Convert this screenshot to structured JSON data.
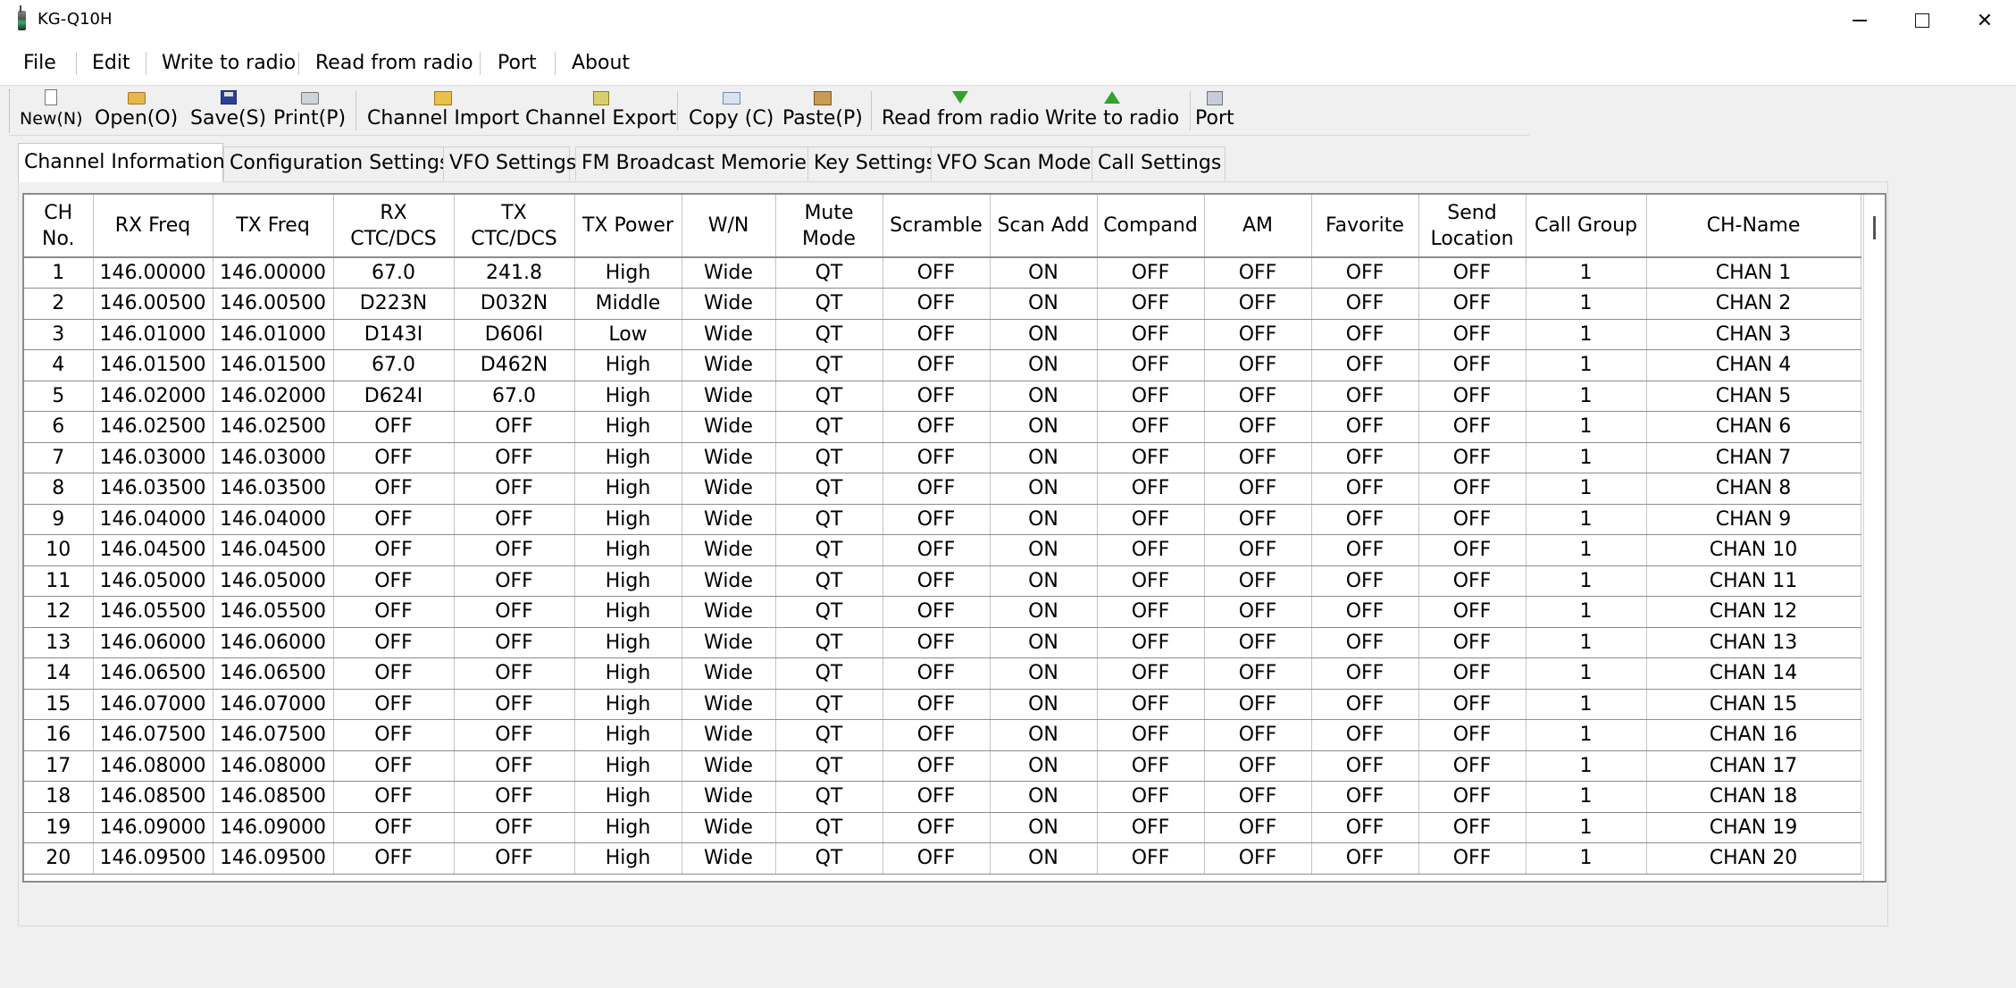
{
  "window": {
    "title": "KG-Q10H",
    "minimize_icon": "minimize-icon",
    "maximize_icon": "maximize-icon",
    "close_icon": "close-icon"
  },
  "menu": [
    "File",
    "Edit",
    "Write to radio",
    "Read from radio",
    "Port",
    "About"
  ],
  "toolbar": [
    {
      "label": "New(N)",
      "icon": "new-file-icon"
    },
    {
      "label": "Open(O)",
      "icon": "open-folder-icon"
    },
    {
      "label": "Save(S)",
      "icon": "save-disk-icon"
    },
    {
      "label": "Print(P)",
      "icon": "printer-icon"
    },
    {
      "label": "Channel Import",
      "icon": "channel-import-icon"
    },
    {
      "label": "Channel Export",
      "icon": "channel-export-icon"
    },
    {
      "label": "Copy (C)",
      "icon": "copy-icon"
    },
    {
      "label": "Paste(P)",
      "icon": "paste-icon"
    },
    {
      "label": "Read from radio",
      "icon": "download-arrow-icon"
    },
    {
      "label": "Write to radio",
      "icon": "upload-arrow-icon"
    },
    {
      "label": "Port",
      "icon": "port-icon"
    }
  ],
  "tabs": [
    "Channel Information",
    "Configuration Settings",
    "VFO Settings",
    "FM Broadcast Memories",
    "Key Settings",
    "VFO Scan Mode",
    "Call Settings"
  ],
  "active_tab": "Channel Information",
  "table": {
    "headers": [
      [
        "CH",
        "No."
      ],
      [
        "RX Freq"
      ],
      [
        "TX Freq"
      ],
      [
        "RX",
        "CTC/DCS"
      ],
      [
        "TX",
        "CTC/DCS"
      ],
      [
        "TX Power"
      ],
      [
        "W/N"
      ],
      [
        "Mute",
        "Mode"
      ],
      [
        "Scramble"
      ],
      [
        "Scan Add"
      ],
      [
        "Compand"
      ],
      [
        "AM"
      ],
      [
        "Favorite"
      ],
      [
        "Send",
        "Location"
      ],
      [
        "Call Group"
      ],
      [
        "CH-Name"
      ]
    ],
    "rows": [
      [
        "1",
        "146.00000",
        "146.00000",
        "67.0",
        "241.8",
        "High",
        "Wide",
        "QT",
        "OFF",
        "ON",
        "OFF",
        "OFF",
        "OFF",
        "OFF",
        "1",
        "CHAN 1"
      ],
      [
        "2",
        "146.00500",
        "146.00500",
        "D223N",
        "D032N",
        "Middle",
        "Wide",
        "QT",
        "OFF",
        "ON",
        "OFF",
        "OFF",
        "OFF",
        "OFF",
        "1",
        "CHAN 2"
      ],
      [
        "3",
        "146.01000",
        "146.01000",
        "D143I",
        "D606I",
        "Low",
        "Wide",
        "QT",
        "OFF",
        "ON",
        "OFF",
        "OFF",
        "OFF",
        "OFF",
        "1",
        "CHAN 3"
      ],
      [
        "4",
        "146.01500",
        "146.01500",
        "67.0",
        "D462N",
        "High",
        "Wide",
        "QT",
        "OFF",
        "ON",
        "OFF",
        "OFF",
        "OFF",
        "OFF",
        "1",
        "CHAN 4"
      ],
      [
        "5",
        "146.02000",
        "146.02000",
        "D624I",
        "67.0",
        "High",
        "Wide",
        "QT",
        "OFF",
        "ON",
        "OFF",
        "OFF",
        "OFF",
        "OFF",
        "1",
        "CHAN 5"
      ],
      [
        "6",
        "146.02500",
        "146.02500",
        "OFF",
        "OFF",
        "High",
        "Wide",
        "QT",
        "OFF",
        "ON",
        "OFF",
        "OFF",
        "OFF",
        "OFF",
        "1",
        "CHAN 6"
      ],
      [
        "7",
        "146.03000",
        "146.03000",
        "OFF",
        "OFF",
        "High",
        "Wide",
        "QT",
        "OFF",
        "ON",
        "OFF",
        "OFF",
        "OFF",
        "OFF",
        "1",
        "CHAN 7"
      ],
      [
        "8",
        "146.03500",
        "146.03500",
        "OFF",
        "OFF",
        "High",
        "Wide",
        "QT",
        "OFF",
        "ON",
        "OFF",
        "OFF",
        "OFF",
        "OFF",
        "1",
        "CHAN 8"
      ],
      [
        "9",
        "146.04000",
        "146.04000",
        "OFF",
        "OFF",
        "High",
        "Wide",
        "QT",
        "OFF",
        "ON",
        "OFF",
        "OFF",
        "OFF",
        "OFF",
        "1",
        "CHAN 9"
      ],
      [
        "10",
        "146.04500",
        "146.04500",
        "OFF",
        "OFF",
        "High",
        "Wide",
        "QT",
        "OFF",
        "ON",
        "OFF",
        "OFF",
        "OFF",
        "OFF",
        "1",
        "CHAN 10"
      ],
      [
        "11",
        "146.05000",
        "146.05000",
        "OFF",
        "OFF",
        "High",
        "Wide",
        "QT",
        "OFF",
        "ON",
        "OFF",
        "OFF",
        "OFF",
        "OFF",
        "1",
        "CHAN 11"
      ],
      [
        "12",
        "146.05500",
        "146.05500",
        "OFF",
        "OFF",
        "High",
        "Wide",
        "QT",
        "OFF",
        "ON",
        "OFF",
        "OFF",
        "OFF",
        "OFF",
        "1",
        "CHAN 12"
      ],
      [
        "13",
        "146.06000",
        "146.06000",
        "OFF",
        "OFF",
        "High",
        "Wide",
        "QT",
        "OFF",
        "ON",
        "OFF",
        "OFF",
        "OFF",
        "OFF",
        "1",
        "CHAN 13"
      ],
      [
        "14",
        "146.06500",
        "146.06500",
        "OFF",
        "OFF",
        "High",
        "Wide",
        "QT",
        "OFF",
        "ON",
        "OFF",
        "OFF",
        "OFF",
        "OFF",
        "1",
        "CHAN 14"
      ],
      [
        "15",
        "146.07000",
        "146.07000",
        "OFF",
        "OFF",
        "High",
        "Wide",
        "QT",
        "OFF",
        "ON",
        "OFF",
        "OFF",
        "OFF",
        "OFF",
        "1",
        "CHAN 15"
      ],
      [
        "16",
        "146.07500",
        "146.07500",
        "OFF",
        "OFF",
        "High",
        "Wide",
        "QT",
        "OFF",
        "ON",
        "OFF",
        "OFF",
        "OFF",
        "OFF",
        "1",
        "CHAN 16"
      ],
      [
        "17",
        "146.08000",
        "146.08000",
        "OFF",
        "OFF",
        "High",
        "Wide",
        "QT",
        "OFF",
        "ON",
        "OFF",
        "OFF",
        "OFF",
        "OFF",
        "1",
        "CHAN 17"
      ],
      [
        "18",
        "146.08500",
        "146.08500",
        "OFF",
        "OFF",
        "High",
        "Wide",
        "QT",
        "OFF",
        "ON",
        "OFF",
        "OFF",
        "OFF",
        "OFF",
        "1",
        "CHAN 18"
      ],
      [
        "19",
        "146.09000",
        "146.09000",
        "OFF",
        "OFF",
        "High",
        "Wide",
        "QT",
        "OFF",
        "ON",
        "OFF",
        "OFF",
        "OFF",
        "OFF",
        "1",
        "CHAN 19"
      ],
      [
        "20",
        "146.09500",
        "146.09500",
        "OFF",
        "OFF",
        "High",
        "Wide",
        "QT",
        "OFF",
        "ON",
        "OFF",
        "OFF",
        "OFF",
        "OFF",
        "1",
        "CHAN 20"
      ]
    ]
  }
}
